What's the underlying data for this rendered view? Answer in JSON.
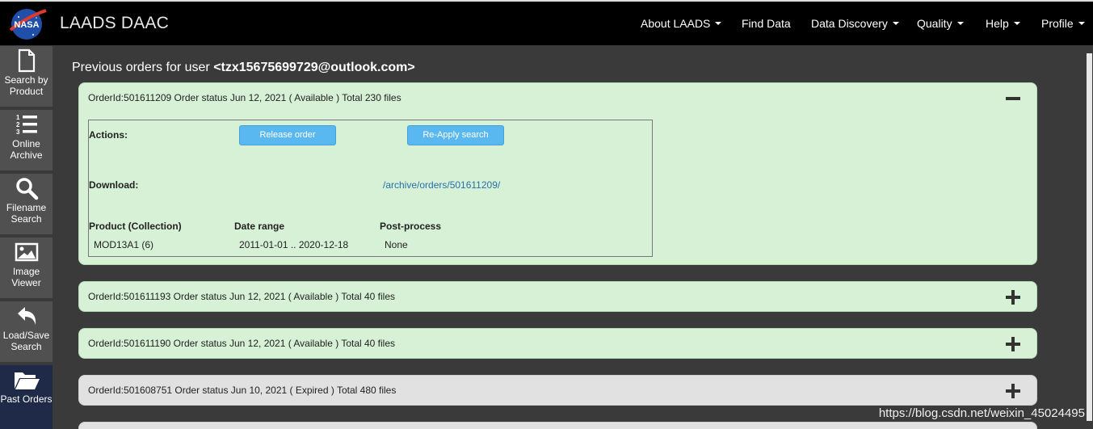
{
  "header": {
    "brand": "LAADS DAAC",
    "nav": [
      {
        "label": "About LAADS",
        "dropdown": true
      },
      {
        "label": "Find Data",
        "dropdown": false
      },
      {
        "label": "Data Discovery",
        "dropdown": true
      },
      {
        "label": "Quality",
        "dropdown": true
      },
      {
        "label": "Help",
        "dropdown": true
      },
      {
        "label": "Profile",
        "dropdown": true
      }
    ]
  },
  "sidebar": {
    "items": [
      {
        "label": "Search by Product",
        "icon": "file-icon"
      },
      {
        "label": "Online Archive",
        "icon": "numbered-list-icon"
      },
      {
        "label": "Filename Search",
        "icon": "magnifier-icon"
      },
      {
        "label": "Image Viewer",
        "icon": "image-icon"
      },
      {
        "label": "Load/Save Search",
        "icon": "undo-arrow-icon"
      },
      {
        "label": "Past Orders",
        "icon": "folder-open-icon",
        "active": true
      }
    ]
  },
  "page": {
    "title_prefix": "Previous orders for user ",
    "user": "<tzx15675699729@outlook.com>"
  },
  "orders": [
    {
      "summary": "OrderId:501611209 Order status Jun 12, 2021 ( Available ) Total 230 files",
      "status": "available",
      "expanded": true,
      "detail": {
        "actions_label": "Actions:",
        "release_button": "Release order",
        "reapply_button": "Re-Apply search",
        "download_label": "Download:",
        "download_link": "/archive/orders/501611209/",
        "col_product": "Product (Collection)",
        "col_date": "Date range",
        "col_post": "Post-process",
        "product": "MOD13A1 (6)",
        "date_range": "2011-01-01 .. 2020-12-18",
        "post_process": "None"
      }
    },
    {
      "summary": "OrderId:501611193 Order status Jun 12, 2021 ( Available ) Total 40 files",
      "status": "available",
      "expanded": false
    },
    {
      "summary": "OrderId:501611190 Order status Jun 12, 2021 ( Available ) Total 40 files",
      "status": "available",
      "expanded": false
    },
    {
      "summary": "OrderId:501608751 Order status Jun 10, 2021 ( Expired ) Total 480 files",
      "status": "expired",
      "expanded": false
    }
  ],
  "watermark": "https://blog.csdn.net/weixin_45024495",
  "colors": {
    "navbar": "#000000",
    "available_panel": "#d6f1d6",
    "expired_panel": "#e1e1e1",
    "button_blue": "#5ab8f0",
    "active_sidebar": "#1e2a47"
  }
}
